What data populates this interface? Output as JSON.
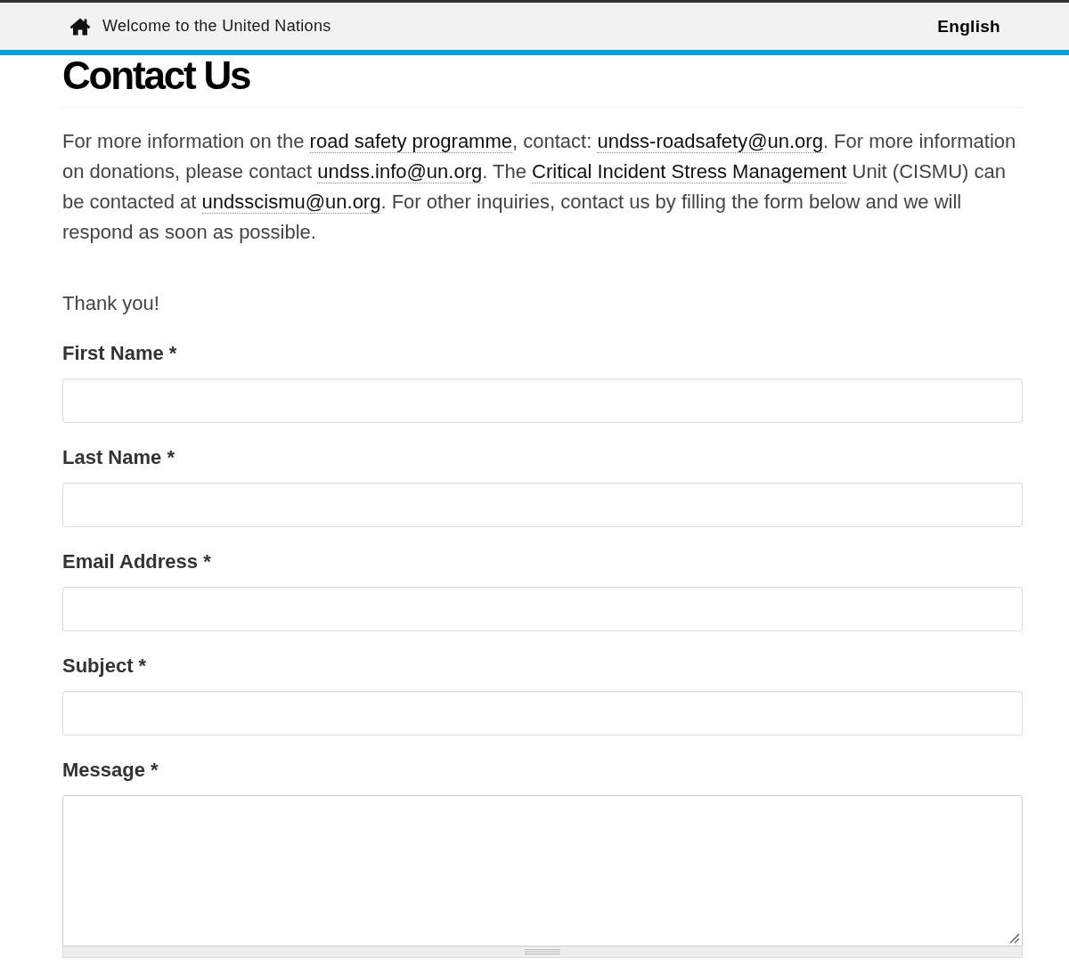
{
  "header": {
    "home_link": "Welcome to the United Nations",
    "language": "English"
  },
  "title": "Contact Us",
  "intro": [
    {
      "kind": "text",
      "text": "For more information on the "
    },
    {
      "kind": "link",
      "text": "road safety programme"
    },
    {
      "kind": "text",
      "text": ", contact: "
    },
    {
      "kind": "link",
      "text": "undss-roadsafety@un.org"
    },
    {
      "kind": "text",
      "text": ". For more information on donations, please contact "
    },
    {
      "kind": "link",
      "text": "undss.info@un.org"
    },
    {
      "kind": "text",
      "text": ". The "
    },
    {
      "kind": "link",
      "text": "Critical Incident Stress Management"
    },
    {
      "kind": "text",
      "text": " Unit (CISMU) can be contacted at "
    },
    {
      "kind": "link",
      "text": "undsscismu@un.org"
    },
    {
      "kind": "text",
      "text": ". For other inquiries, contact us by filling the form below and we will respond as soon as possible."
    }
  ],
  "thanks": "Thank you!",
  "form": {
    "fields": [
      {
        "kind": "input",
        "label": "First Name *"
      },
      {
        "kind": "input",
        "label": "Last Name *"
      },
      {
        "kind": "input",
        "label": "Email Address *"
      },
      {
        "kind": "input",
        "label": "Subject *"
      },
      {
        "kind": "textarea",
        "label": "Message *"
      }
    ]
  }
}
